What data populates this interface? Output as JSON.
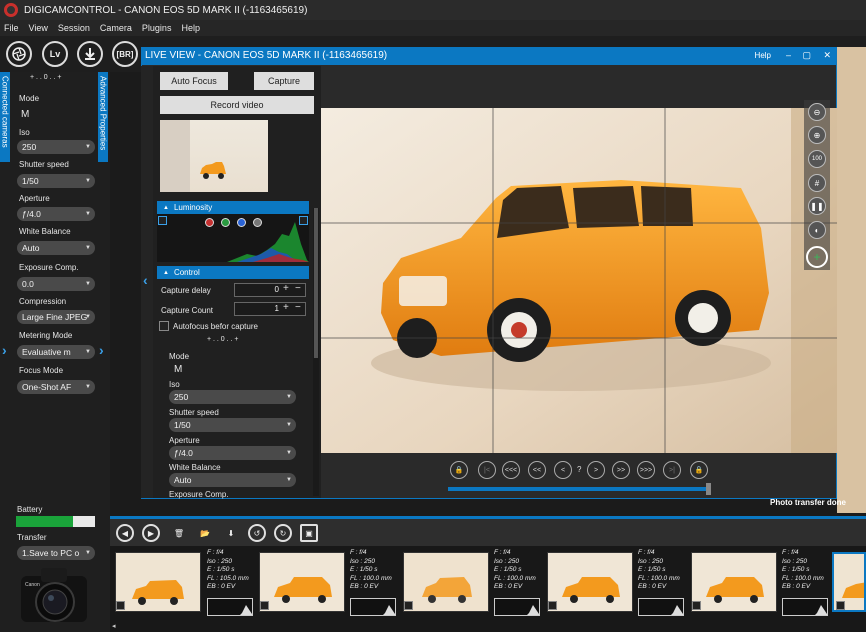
{
  "app": {
    "title": "DIGICAMCONTROL - CANON EOS 5D MARK II (-1163465619)"
  },
  "menu": [
    "File",
    "View",
    "Session",
    "Camera",
    "Plugins",
    "Help"
  ],
  "toolbar": {
    "lv_label": "Lv",
    "br_label": "[BR]"
  },
  "left": {
    "tab_connected": "Connected cameras",
    "tab_advanced": "Advanced Properties",
    "mode_label": "Mode",
    "mode_value": "M",
    "iso_label": "Iso",
    "iso_value": "250",
    "shutter_label": "Shutter speed",
    "shutter_value": "1/50",
    "aperture_label": "Aperture",
    "aperture_value": "ƒ/4.0",
    "wb_label": "White Balance",
    "wb_value": "Auto",
    "exp_label": "Exposure Comp.",
    "exp_value": "0.0",
    "comp_label": "Compression",
    "comp_value": "Large Fine JPEG",
    "meter_label": "Metering Mode",
    "meter_value": "Evaluative m",
    "focus_label": "Focus Mode",
    "focus_value": "One-Shot AF",
    "battery_label": "Battery",
    "battery_level": 0.72,
    "transfer_label": "Transfer",
    "transfer_value": "1.Save to PC o",
    "scale_text": "+ . . 0 . . +"
  },
  "liveview": {
    "title": "LIVE VIEW - CANON EOS 5D MARK II (-1163465619)",
    "help": "Help",
    "autofocus": "Auto Focus",
    "capture": "Capture",
    "record": "Record video",
    "luminosity": "Luminosity",
    "control": "Control",
    "capture_delay_label": "Capture delay",
    "capture_delay_value": "0",
    "capture_count_label": "Capture Count",
    "capture_count_value": "1",
    "autofocus_before": "Autofocus befor capture",
    "mode_label": "Mode",
    "mode_value": "M",
    "iso_label": "Iso",
    "iso_value": "250",
    "shutter_label": "Shutter speed",
    "shutter_value": "1/50",
    "aperture_label": "Aperture",
    "aperture_value": "ƒ/4.0",
    "wb_label": "White Balance",
    "wb_value": "Auto",
    "exp_label": "Exposure Comp.",
    "side_100": "100",
    "nav": [
      "<<<",
      "<<",
      "<",
      "?",
      ">",
      ">>",
      ">>>",
      ">|"
    ],
    "nav_first": "|<",
    "progress": 1.0,
    "status": "Photo transfer done"
  },
  "thumbs": [
    {
      "f": "F : f/4",
      "iso": "Iso : 250",
      "e": "E : 1/50 s",
      "fl": "FL : 105.0 mm",
      "eb": "EB : 0 EV"
    },
    {
      "f": "F : f/4",
      "iso": "Iso : 250",
      "e": "E : 1/50 s",
      "fl": "FL : 100.0 mm",
      "eb": "EB : 0 EV"
    },
    {
      "f": "F : f/4",
      "iso": "Iso : 250",
      "e": "E : 1/50 s",
      "fl": "FL : 100.0 mm",
      "eb": "EB : 0 EV"
    },
    {
      "f": "F : f/4",
      "iso": "Iso : 250",
      "e": "E : 1/50 s",
      "fl": "FL : 100.0 mm",
      "eb": "EB : 0 EV"
    },
    {
      "f": "F : f/4",
      "iso": "Iso : 250",
      "e": "E : 1/50 s",
      "fl": "FL : 100.0 mm",
      "eb": "EB : 0 EV"
    }
  ],
  "colors": {
    "accent": "#0b78c2",
    "orange": "#f39a1e",
    "battery": "#1aa33a"
  }
}
